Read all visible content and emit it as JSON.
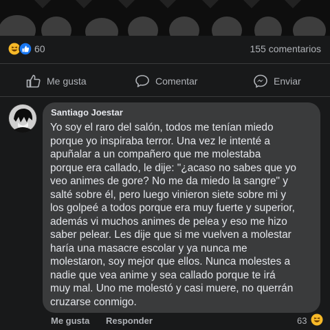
{
  "reactions": {
    "count": "60",
    "comments": "155 comentarios"
  },
  "actions": {
    "like": "Me gusta",
    "comment": "Comentar",
    "share": "Enviar"
  },
  "comment": {
    "author": "Santiago Joestar",
    "lines": [
      "Yo soy el raro del salón, todos me tenían miedo",
      "porque yo inspiraba terror. Una vez le intenté a",
      "apuñalar a un compañero que me molestaba",
      "porque era callado, le dije: \"¿acaso no sabes que yo",
      "veo animes de gore? No me da miedo la sangre\" y",
      "salté sobre él, pero luego vinieron siete sobre mi y",
      "los golpeé a todos porque era muy fuerte y superior,",
      "además vi muchos animes de pelea y eso me hizo",
      "saber pelear. Les dije que si me vuelven a molestar",
      "haría una masacre escolar y ya nunca me",
      "molestaron, soy mejor que ellos. Nunca molestes a",
      "nadie que vea anime y sea callado porque te irá",
      "muy mal. Uno me molestó y casi muere, no querrán",
      "cruzarse conmigo."
    ]
  },
  "footer": {
    "like": "Me gusta",
    "reply": "Responder",
    "reaction_count": "63"
  },
  "colors": {
    "background": "#18191a",
    "bubble": "#3a3b3c",
    "like_blue": "#1877f2",
    "haha_yellow": "#f7b928"
  }
}
